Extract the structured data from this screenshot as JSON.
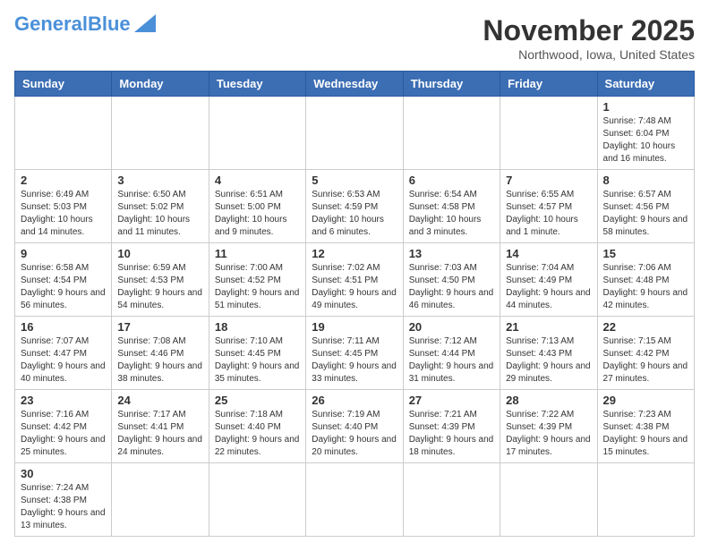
{
  "header": {
    "logo_general": "General",
    "logo_blue": "Blue",
    "month_title": "November 2025",
    "location": "Northwood, Iowa, United States"
  },
  "days_of_week": [
    "Sunday",
    "Monday",
    "Tuesday",
    "Wednesday",
    "Thursday",
    "Friday",
    "Saturday"
  ],
  "weeks": [
    [
      {
        "day": "",
        "info": ""
      },
      {
        "day": "",
        "info": ""
      },
      {
        "day": "",
        "info": ""
      },
      {
        "day": "",
        "info": ""
      },
      {
        "day": "",
        "info": ""
      },
      {
        "day": "",
        "info": ""
      },
      {
        "day": "1",
        "info": "Sunrise: 7:48 AM\nSunset: 6:04 PM\nDaylight: 10 hours and 16 minutes."
      }
    ],
    [
      {
        "day": "2",
        "info": "Sunrise: 6:49 AM\nSunset: 5:03 PM\nDaylight: 10 hours and 14 minutes."
      },
      {
        "day": "3",
        "info": "Sunrise: 6:50 AM\nSunset: 5:02 PM\nDaylight: 10 hours and 11 minutes."
      },
      {
        "day": "4",
        "info": "Sunrise: 6:51 AM\nSunset: 5:00 PM\nDaylight: 10 hours and 9 minutes."
      },
      {
        "day": "5",
        "info": "Sunrise: 6:53 AM\nSunset: 4:59 PM\nDaylight: 10 hours and 6 minutes."
      },
      {
        "day": "6",
        "info": "Sunrise: 6:54 AM\nSunset: 4:58 PM\nDaylight: 10 hours and 3 minutes."
      },
      {
        "day": "7",
        "info": "Sunrise: 6:55 AM\nSunset: 4:57 PM\nDaylight: 10 hours and 1 minute."
      },
      {
        "day": "8",
        "info": "Sunrise: 6:57 AM\nSunset: 4:56 PM\nDaylight: 9 hours and 58 minutes."
      }
    ],
    [
      {
        "day": "9",
        "info": "Sunrise: 6:58 AM\nSunset: 4:54 PM\nDaylight: 9 hours and 56 minutes."
      },
      {
        "day": "10",
        "info": "Sunrise: 6:59 AM\nSunset: 4:53 PM\nDaylight: 9 hours and 54 minutes."
      },
      {
        "day": "11",
        "info": "Sunrise: 7:00 AM\nSunset: 4:52 PM\nDaylight: 9 hours and 51 minutes."
      },
      {
        "day": "12",
        "info": "Sunrise: 7:02 AM\nSunset: 4:51 PM\nDaylight: 9 hours and 49 minutes."
      },
      {
        "day": "13",
        "info": "Sunrise: 7:03 AM\nSunset: 4:50 PM\nDaylight: 9 hours and 46 minutes."
      },
      {
        "day": "14",
        "info": "Sunrise: 7:04 AM\nSunset: 4:49 PM\nDaylight: 9 hours and 44 minutes."
      },
      {
        "day": "15",
        "info": "Sunrise: 7:06 AM\nSunset: 4:48 PM\nDaylight: 9 hours and 42 minutes."
      }
    ],
    [
      {
        "day": "16",
        "info": "Sunrise: 7:07 AM\nSunset: 4:47 PM\nDaylight: 9 hours and 40 minutes."
      },
      {
        "day": "17",
        "info": "Sunrise: 7:08 AM\nSunset: 4:46 PM\nDaylight: 9 hours and 38 minutes."
      },
      {
        "day": "18",
        "info": "Sunrise: 7:10 AM\nSunset: 4:45 PM\nDaylight: 9 hours and 35 minutes."
      },
      {
        "day": "19",
        "info": "Sunrise: 7:11 AM\nSunset: 4:45 PM\nDaylight: 9 hours and 33 minutes."
      },
      {
        "day": "20",
        "info": "Sunrise: 7:12 AM\nSunset: 4:44 PM\nDaylight: 9 hours and 31 minutes."
      },
      {
        "day": "21",
        "info": "Sunrise: 7:13 AM\nSunset: 4:43 PM\nDaylight: 9 hours and 29 minutes."
      },
      {
        "day": "22",
        "info": "Sunrise: 7:15 AM\nSunset: 4:42 PM\nDaylight: 9 hours and 27 minutes."
      }
    ],
    [
      {
        "day": "23",
        "info": "Sunrise: 7:16 AM\nSunset: 4:42 PM\nDaylight: 9 hours and 25 minutes."
      },
      {
        "day": "24",
        "info": "Sunrise: 7:17 AM\nSunset: 4:41 PM\nDaylight: 9 hours and 24 minutes."
      },
      {
        "day": "25",
        "info": "Sunrise: 7:18 AM\nSunset: 4:40 PM\nDaylight: 9 hours and 22 minutes."
      },
      {
        "day": "26",
        "info": "Sunrise: 7:19 AM\nSunset: 4:40 PM\nDaylight: 9 hours and 20 minutes."
      },
      {
        "day": "27",
        "info": "Sunrise: 7:21 AM\nSunset: 4:39 PM\nDaylight: 9 hours and 18 minutes."
      },
      {
        "day": "28",
        "info": "Sunrise: 7:22 AM\nSunset: 4:39 PM\nDaylight: 9 hours and 17 minutes."
      },
      {
        "day": "29",
        "info": "Sunrise: 7:23 AM\nSunset: 4:38 PM\nDaylight: 9 hours and 15 minutes."
      }
    ],
    [
      {
        "day": "30",
        "info": "Sunrise: 7:24 AM\nSunset: 4:38 PM\nDaylight: 9 hours and 13 minutes."
      },
      {
        "day": "",
        "info": ""
      },
      {
        "day": "",
        "info": ""
      },
      {
        "day": "",
        "info": ""
      },
      {
        "day": "",
        "info": ""
      },
      {
        "day": "",
        "info": ""
      },
      {
        "day": "",
        "info": ""
      }
    ]
  ]
}
